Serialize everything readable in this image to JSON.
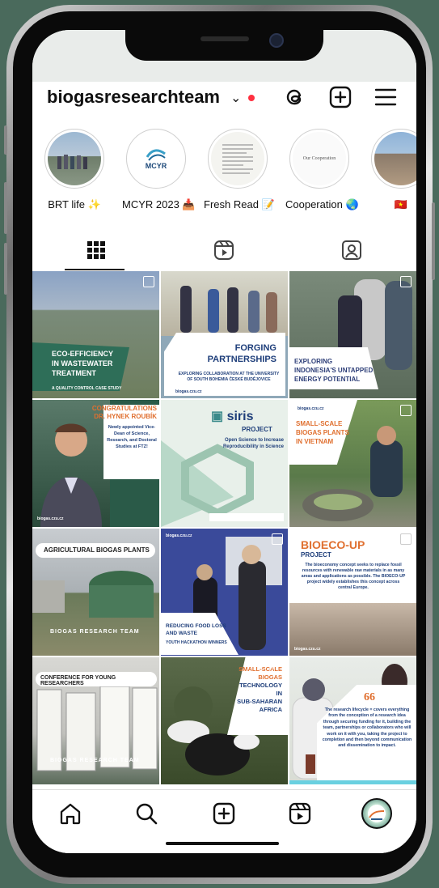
{
  "profile": {
    "username": "biogasresearchteam"
  },
  "highlights": [
    {
      "label": "BRT life ✨"
    },
    {
      "label": "MCYR 2023 📥"
    },
    {
      "label": "Fresh Read 📝"
    },
    {
      "label": "Cooperation 🌏"
    },
    {
      "label": "🇻🇳"
    }
  ],
  "highlight_texts": {
    "mcyr_logo": "MCYR",
    "cooperation": "Our Cooperation"
  },
  "posts": [
    {
      "lines": [
        "ECO-EFFICIENCY",
        "IN WASTEWATER",
        "TREATMENT"
      ],
      "sub": "A QUALITY CONTROL CASE STUDY"
    },
    {
      "lines": [
        "FORGING",
        "PARTNERSHIPS"
      ],
      "sub": "EXPLORING COLLABORATION AT THE UNIVERSITY OF SOUTH BOHEMIA ČESKÉ BUDĚJOVICE"
    },
    {
      "lines": [
        "EXPLORING",
        "INDONESIA'S UNTAPPED",
        "ENERGY POTENTIAL"
      ]
    },
    {
      "lines": [
        "CONGRATULATIONS",
        "DR. HYNEK ROUBÍK"
      ],
      "sub": "Newly appointed Vice-Dean of Science, Research, and Doctoral Studies at FTZ!"
    },
    {
      "lines": [
        "siris",
        "PROJECT"
      ],
      "sub": "Open Science to Increase Reproducibility in Science"
    },
    {
      "lines": [
        "SMALL-SCALE",
        "BIOGAS PLANTS",
        "IN VIETNAM"
      ]
    },
    {
      "lines": [
        "AGRICULTURAL BIOGAS PLANTS"
      ],
      "sub": "BIOGAS RESEARCH TEAM"
    },
    {
      "lines": [
        "REDUCING FOOD LOSS",
        "AND WASTE"
      ],
      "sub": "YOUTH HACKATHON WINNERS"
    },
    {
      "lines": [
        "BIOECO-UP",
        "PROJECT"
      ],
      "sub": "The bioeconomy concept seeks to replace fossil resources with renewable raw materials in as many areas and applications as possible. The BIOECO-UP project widely establishes this concept across central Europe."
    },
    {
      "lines": [
        "CONFERENCE FOR YOUNG RESEARCHERS"
      ],
      "sub": "BIOGAS RESEARCH TEAM"
    },
    {
      "lines": [
        "SMALL-SCALE",
        "BIOGAS",
        "TECHNOLOGY IN",
        "SUB-SAHARAN",
        "AFRICA"
      ]
    },
    {
      "lines": [
        "66"
      ],
      "sub": "The research lifecycle = covers everything from the conception of a research idea through securing funding for it, building the team, partnerships or collaborators who will work on it with you, taking the project to completion and then beyond communication and dissemination to impact."
    }
  ],
  "website": "biogas.czu.cz",
  "icons": {
    "threads": "threads-icon",
    "create": "plus-square-icon",
    "menu": "hamburger-menu-icon",
    "grid_tab": "grid-icon",
    "reels_tab": "reels-icon",
    "tagged_tab": "tagged-icon",
    "home": "home-icon",
    "search": "search-icon",
    "reels": "reels-icon",
    "profile": "avatar"
  }
}
